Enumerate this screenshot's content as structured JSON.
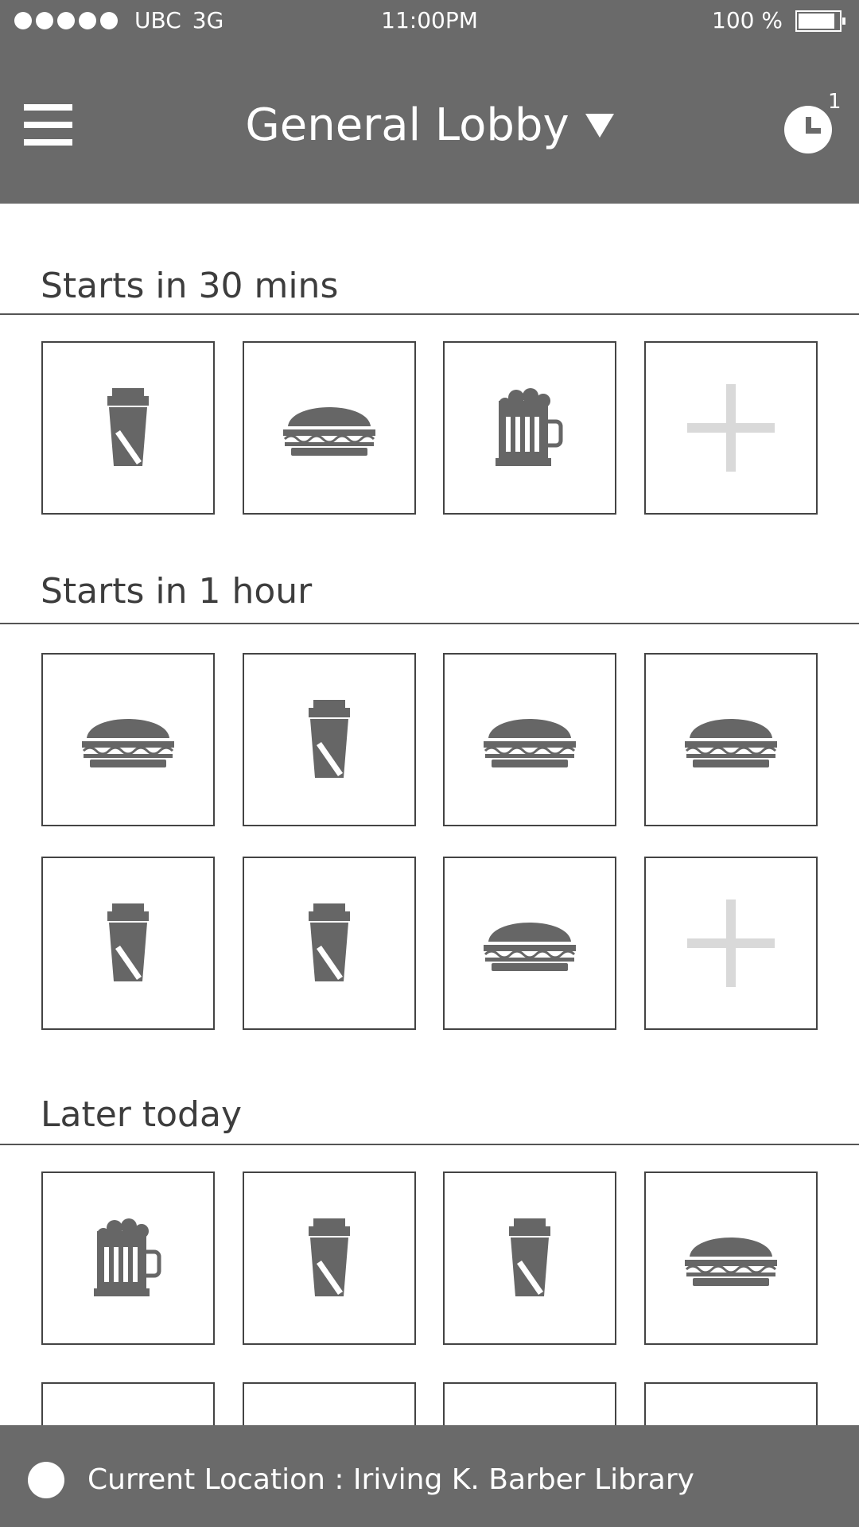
{
  "status_bar": {
    "carrier": "UBC",
    "network": "3G",
    "time": "11:00PM",
    "battery_text": "100 %",
    "signal_dots": 5,
    "battery_level": 0.9
  },
  "header": {
    "menu_icon": "hamburger-icon",
    "title": "General Lobby",
    "dropdown_icon": "caret-down-icon",
    "history_icon": "clock-icon",
    "history_badge": "1"
  },
  "sections": [
    {
      "title": "Starts in 30 mins",
      "tiles": [
        "coffee-icon",
        "burger-icon",
        "beer-icon",
        "plus-icon"
      ]
    },
    {
      "title": "Starts in 1 hour",
      "tiles": [
        "burger-icon",
        "coffee-icon",
        "burger-icon",
        "burger-icon",
        "coffee-icon",
        "coffee-icon",
        "burger-icon",
        "plus-icon"
      ]
    },
    {
      "title": "Later today",
      "tiles": [
        "beer-icon",
        "coffee-icon",
        "coffee-icon",
        "burger-icon",
        "",
        "",
        "",
        ""
      ]
    }
  ],
  "footer": {
    "location_label": "Current Location : Iriving K. Barber Library",
    "location_icon": "location-dot-icon"
  },
  "colors": {
    "bar_background": "#6a6a6a",
    "icon_fill": "#666666",
    "plus_fill": "#d9d9d9",
    "text_dark": "#3d3d3d"
  }
}
